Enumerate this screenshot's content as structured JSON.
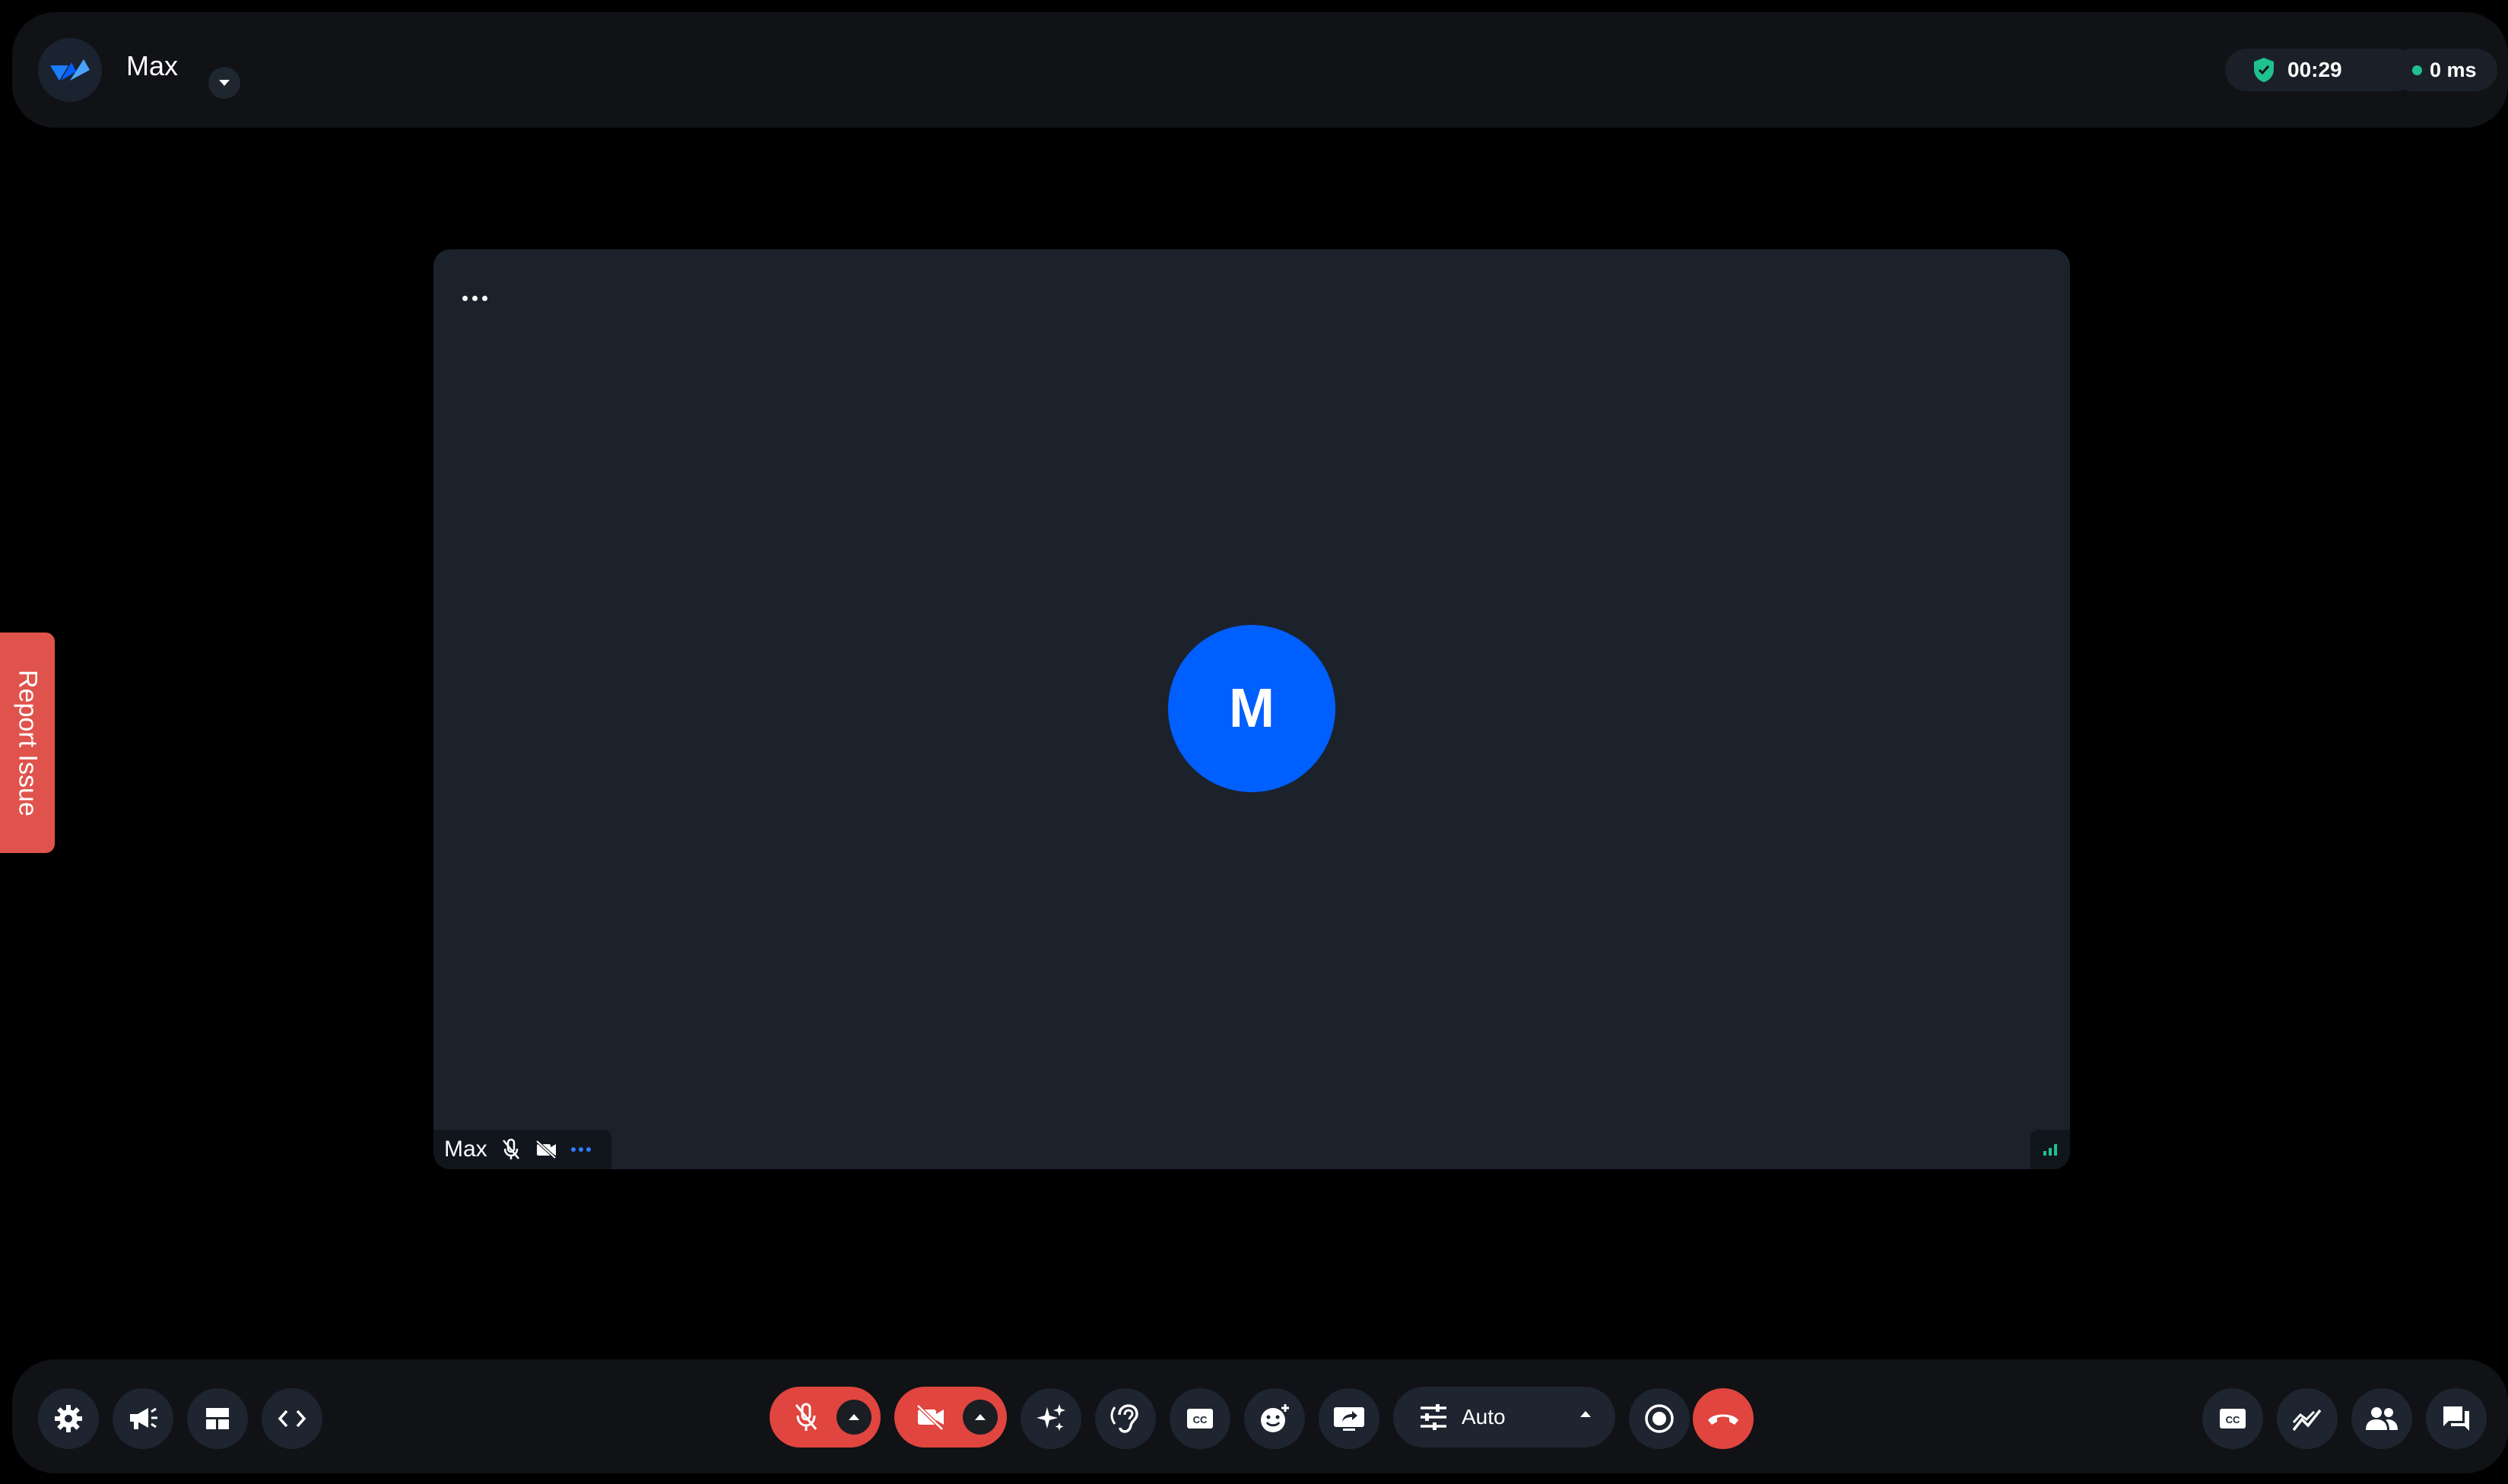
{
  "header": {
    "title": "Max",
    "timer": "00:29",
    "latency": "0 ms",
    "logo_icon": "app-logo-icon",
    "shield_color": "#1fc18f"
  },
  "report": {
    "label": "Report Issue"
  },
  "tile": {
    "avatar_initial": "M",
    "participant_name": "Max",
    "avatar_color": "#005fff"
  },
  "controls": {
    "left": [
      "gear-icon",
      "megaphone-icon",
      "layout-icon",
      "code-icon"
    ],
    "center": [
      "mic-off-icon",
      "camera-off-icon",
      "sparkles-icon",
      "hearing-icon",
      "captions-icon",
      "reaction-icon",
      "screen-share-icon",
      "tune-icon",
      "record-icon",
      "hangup-icon"
    ],
    "right": [
      "captions-icon",
      "stats-icon",
      "participants-icon",
      "chat-icon"
    ],
    "quality_label": "Auto"
  },
  "colors": {
    "danger": "#e0453f",
    "accent": "#005fff",
    "success": "#1fc18f"
  }
}
